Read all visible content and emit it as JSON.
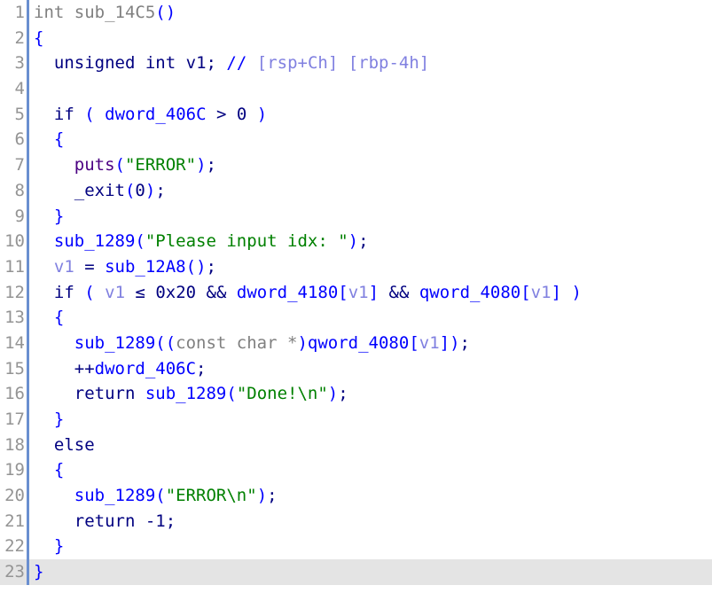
{
  "view": {
    "name": "hex-rays-pseudocode",
    "current_line": 23,
    "total_lines": 23,
    "colors": {
      "background": "#ffffff",
      "current_line_highlight": "#e4e4e4",
      "gutter_text": "#949494",
      "rail": "#6a8fd0",
      "type": "#808080",
      "punctuation": "#0000ff",
      "keyword": "#000080",
      "global_variable": "#0000ff",
      "function": "#0000ff",
      "library_function": "#4b0082",
      "local_variable": "#8080e0",
      "string": "#008000",
      "comment_marker": "#0000ff",
      "comment_text": "#8080e0"
    }
  },
  "lines": [
    {
      "number": "1",
      "tokens": [
        {
          "t": "int",
          "c": "t-type"
        },
        {
          "t": " ",
          "c": "t-plain"
        },
        {
          "t": "sub_14C5",
          "c": "t-funcdecl"
        },
        {
          "t": "()",
          "c": "t-punct"
        }
      ]
    },
    {
      "number": "2",
      "tokens": [
        {
          "t": "{",
          "c": "t-punct"
        }
      ]
    },
    {
      "number": "3",
      "tokens": [
        {
          "t": "  ",
          "c": "t-plain"
        },
        {
          "t": "unsigned int",
          "c": "t-keyword"
        },
        {
          "t": " ",
          "c": "t-plain"
        },
        {
          "t": "v1",
          "c": "t-keyword"
        },
        {
          "t": "; ",
          "c": "t-plain"
        },
        {
          "t": "//",
          "c": "t-comment"
        },
        {
          "t": " ",
          "c": "t-plain"
        },
        {
          "t": "[rsp+Ch] [rbp-4h]",
          "c": "t-cmttext"
        }
      ]
    },
    {
      "number": "4",
      "tokens": []
    },
    {
      "number": "5",
      "tokens": [
        {
          "t": "  ",
          "c": "t-plain"
        },
        {
          "t": "if",
          "c": "t-keyword"
        },
        {
          "t": " ",
          "c": "t-plain"
        },
        {
          "t": "(",
          "c": "t-punct"
        },
        {
          "t": " ",
          "c": "t-plain"
        },
        {
          "t": "dword_406C",
          "c": "t-gvar"
        },
        {
          "t": " > 0 ",
          "c": "t-plain"
        },
        {
          "t": ")",
          "c": "t-punct"
        }
      ]
    },
    {
      "number": "6",
      "tokens": [
        {
          "t": "  ",
          "c": "t-plain"
        },
        {
          "t": "{",
          "c": "t-punct"
        }
      ]
    },
    {
      "number": "7",
      "tokens": [
        {
          "t": "    ",
          "c": "t-plain"
        },
        {
          "t": "puts",
          "c": "t-libfunc"
        },
        {
          "t": "(",
          "c": "t-punct"
        },
        {
          "t": "\"ERROR\"",
          "c": "t-string"
        },
        {
          "t": ")",
          "c": "t-punct"
        },
        {
          "t": ";",
          "c": "t-plain"
        }
      ]
    },
    {
      "number": "8",
      "tokens": [
        {
          "t": "    ",
          "c": "t-plain"
        },
        {
          "t": "_exit",
          "c": "t-keyword"
        },
        {
          "t": "(",
          "c": "t-punct"
        },
        {
          "t": "0",
          "c": "t-plain"
        },
        {
          "t": ")",
          "c": "t-punct"
        },
        {
          "t": ";",
          "c": "t-plain"
        }
      ]
    },
    {
      "number": "9",
      "tokens": [
        {
          "t": "  ",
          "c": "t-plain"
        },
        {
          "t": "}",
          "c": "t-punct"
        }
      ]
    },
    {
      "number": "10",
      "tokens": [
        {
          "t": "  ",
          "c": "t-plain"
        },
        {
          "t": "sub_1289",
          "c": "t-func"
        },
        {
          "t": "(",
          "c": "t-punct"
        },
        {
          "t": "\"Please input idx: \"",
          "c": "t-string"
        },
        {
          "t": ")",
          "c": "t-punct"
        },
        {
          "t": ";",
          "c": "t-plain"
        }
      ]
    },
    {
      "number": "11",
      "tokens": [
        {
          "t": "  ",
          "c": "t-plain"
        },
        {
          "t": "v1",
          "c": "t-lvar"
        },
        {
          "t": " = ",
          "c": "t-plain"
        },
        {
          "t": "sub_12A8",
          "c": "t-func"
        },
        {
          "t": "()",
          "c": "t-punct"
        },
        {
          "t": ";",
          "c": "t-plain"
        }
      ]
    },
    {
      "number": "12",
      "tokens": [
        {
          "t": "  ",
          "c": "t-plain"
        },
        {
          "t": "if",
          "c": "t-keyword"
        },
        {
          "t": " ",
          "c": "t-plain"
        },
        {
          "t": "(",
          "c": "t-punct"
        },
        {
          "t": " ",
          "c": "t-plain"
        },
        {
          "t": "v1",
          "c": "t-lvar"
        },
        {
          "t": " ≤ 0x20 && ",
          "c": "t-plain"
        },
        {
          "t": "dword_4180",
          "c": "t-gvar"
        },
        {
          "t": "[",
          "c": "t-punct"
        },
        {
          "t": "v1",
          "c": "t-lvar"
        },
        {
          "t": "]",
          "c": "t-punct"
        },
        {
          "t": " && ",
          "c": "t-plain"
        },
        {
          "t": "qword_4080",
          "c": "t-gvar"
        },
        {
          "t": "[",
          "c": "t-punct"
        },
        {
          "t": "v1",
          "c": "t-lvar"
        },
        {
          "t": "]",
          "c": "t-punct"
        },
        {
          "t": " ",
          "c": "t-plain"
        },
        {
          "t": ")",
          "c": "t-punct"
        }
      ]
    },
    {
      "number": "13",
      "tokens": [
        {
          "t": "  ",
          "c": "t-plain"
        },
        {
          "t": "{",
          "c": "t-punct"
        }
      ]
    },
    {
      "number": "14",
      "tokens": [
        {
          "t": "    ",
          "c": "t-plain"
        },
        {
          "t": "sub_1289",
          "c": "t-func"
        },
        {
          "t": "((",
          "c": "t-punct"
        },
        {
          "t": "const char",
          "c": "t-type"
        },
        {
          "t": " ",
          "c": "t-plain"
        },
        {
          "t": "*",
          "c": "t-type"
        },
        {
          "t": ")",
          "c": "t-punct"
        },
        {
          "t": "qword_4080",
          "c": "t-gvar"
        },
        {
          "t": "[",
          "c": "t-punct"
        },
        {
          "t": "v1",
          "c": "t-lvar"
        },
        {
          "t": "])",
          "c": "t-punct"
        },
        {
          "t": ";",
          "c": "t-plain"
        }
      ]
    },
    {
      "number": "15",
      "tokens": [
        {
          "t": "    ",
          "c": "t-plain"
        },
        {
          "t": "++",
          "c": "t-plain"
        },
        {
          "t": "dword_406C",
          "c": "t-gvar"
        },
        {
          "t": ";",
          "c": "t-plain"
        }
      ]
    },
    {
      "number": "16",
      "tokens": [
        {
          "t": "    ",
          "c": "t-plain"
        },
        {
          "t": "return",
          "c": "t-keyword"
        },
        {
          "t": " ",
          "c": "t-plain"
        },
        {
          "t": "sub_1289",
          "c": "t-func"
        },
        {
          "t": "(",
          "c": "t-punct"
        },
        {
          "t": "\"Done!\\n\"",
          "c": "t-string"
        },
        {
          "t": ")",
          "c": "t-punct"
        },
        {
          "t": ";",
          "c": "t-plain"
        }
      ]
    },
    {
      "number": "17",
      "tokens": [
        {
          "t": "  ",
          "c": "t-plain"
        },
        {
          "t": "}",
          "c": "t-punct"
        }
      ]
    },
    {
      "number": "18",
      "tokens": [
        {
          "t": "  ",
          "c": "t-plain"
        },
        {
          "t": "else",
          "c": "t-keyword"
        }
      ]
    },
    {
      "number": "19",
      "tokens": [
        {
          "t": "  ",
          "c": "t-plain"
        },
        {
          "t": "{",
          "c": "t-punct"
        }
      ]
    },
    {
      "number": "20",
      "tokens": [
        {
          "t": "    ",
          "c": "t-plain"
        },
        {
          "t": "sub_1289",
          "c": "t-func"
        },
        {
          "t": "(",
          "c": "t-punct"
        },
        {
          "t": "\"ERROR\\n\"",
          "c": "t-string"
        },
        {
          "t": ")",
          "c": "t-punct"
        },
        {
          "t": ";",
          "c": "t-plain"
        }
      ]
    },
    {
      "number": "21",
      "tokens": [
        {
          "t": "    ",
          "c": "t-plain"
        },
        {
          "t": "return",
          "c": "t-keyword"
        },
        {
          "t": " -1;",
          "c": "t-plain"
        }
      ]
    },
    {
      "number": "22",
      "tokens": [
        {
          "t": "  ",
          "c": "t-plain"
        },
        {
          "t": "}",
          "c": "t-punct"
        }
      ]
    },
    {
      "number": "23",
      "tokens": [
        {
          "t": "}",
          "c": "t-punct"
        }
      ]
    }
  ]
}
